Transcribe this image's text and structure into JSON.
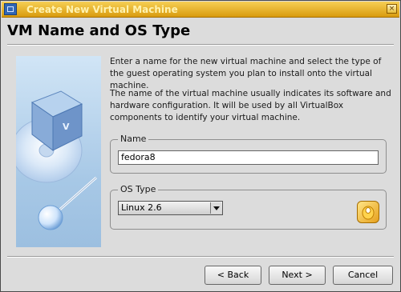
{
  "window": {
    "title": "Create New Virtual Machine"
  },
  "page": {
    "heading": "VM Name and OS Type",
    "paragraph1": "Enter a name for the new virtual machine and select the type of the guest operating system you plan to install onto the virtual machine.",
    "paragraph2": "The name of the virtual machine usually indicates its software and hardware configuration. It will be used by all VirtualBox components to identify your virtual machine."
  },
  "name_group": {
    "label": "Name",
    "value": "fedora8"
  },
  "os_group": {
    "label": "OS Type",
    "selected": "Linux 2.6"
  },
  "buttons": {
    "back": "< Back",
    "next": "Next >",
    "cancel": "Cancel"
  },
  "icons": {
    "app": "virtualbox-icon",
    "os": "linux-os-icon",
    "side": "virtualbox-cube-illustration"
  },
  "colors": {
    "titlebar": "#e3a91c",
    "window_bg": "#dcdcdc",
    "side_panel": "#b9d4ee"
  }
}
